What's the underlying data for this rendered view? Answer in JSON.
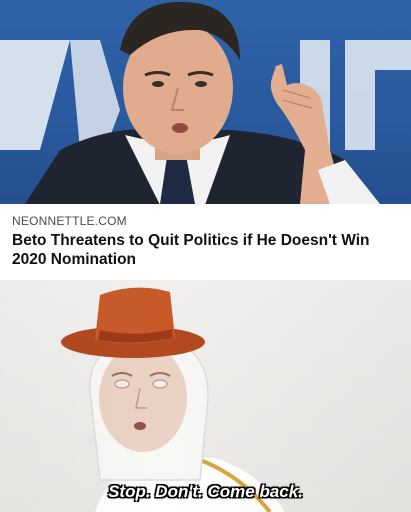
{
  "headline_card": {
    "source": "NEONNETTLE.COM",
    "headline": "Beto Threatens to Quit Politics if He Doesn't Win 2020 Nomination"
  },
  "caption": {
    "subtitle": "Stop. Don't. Come back."
  },
  "colors": {
    "banner_blue": "#2a5aa0",
    "hat_orange": "#c85a2a",
    "subtitle_text": "#ffffff"
  }
}
